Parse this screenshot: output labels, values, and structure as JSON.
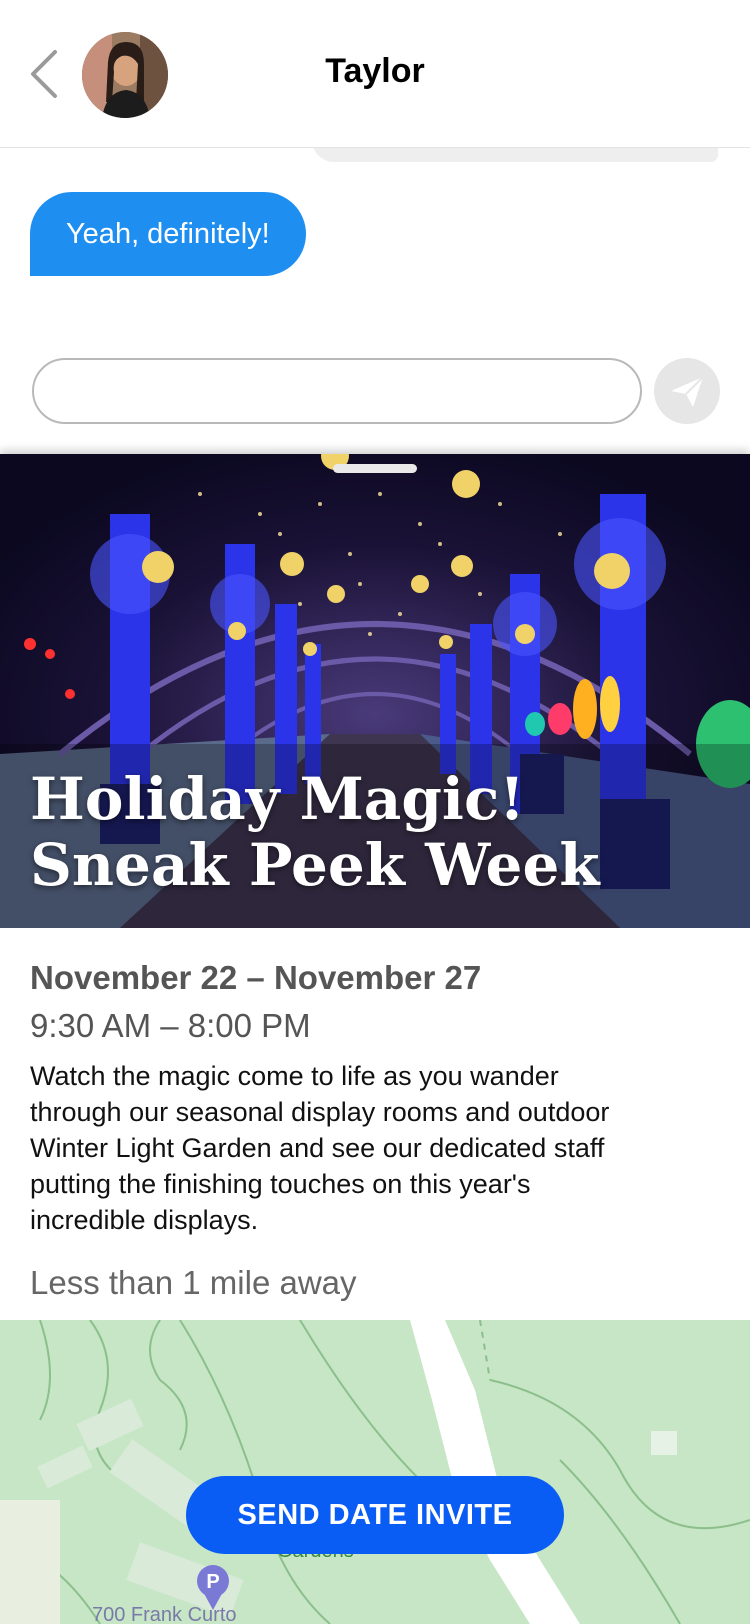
{
  "header": {
    "title": "Taylor",
    "back_icon": "chevron-left-icon",
    "avatar_alt": "Taylor avatar"
  },
  "chat": {
    "messages": [
      {
        "text": "Yeah, definitely!",
        "sender": "me"
      }
    ],
    "composer_placeholder": "",
    "send_icon": "paper-plane-icon"
  },
  "event": {
    "title_line1": "Holiday Magic!",
    "title_line2": "Sneak Peek Week",
    "dates": "November 22 – November 27",
    "hours": "9:30 AM – 8:00 PM",
    "description": "Watch the magic come to life as you wander through our seasonal display rooms and outdoor Winter Light Garden and see our dedicated staff putting the finishing touches on this year's incredible displays.",
    "distance": "Less than 1 mile away",
    "map": {
      "label": "Gardens",
      "address": "700 Frank Curto"
    },
    "invite_label": "SEND DATE INVITE"
  },
  "colors": {
    "accent_blue": "#1f8ef1",
    "button_blue": "#0a5df4",
    "map_green": "#c6e6c6"
  }
}
